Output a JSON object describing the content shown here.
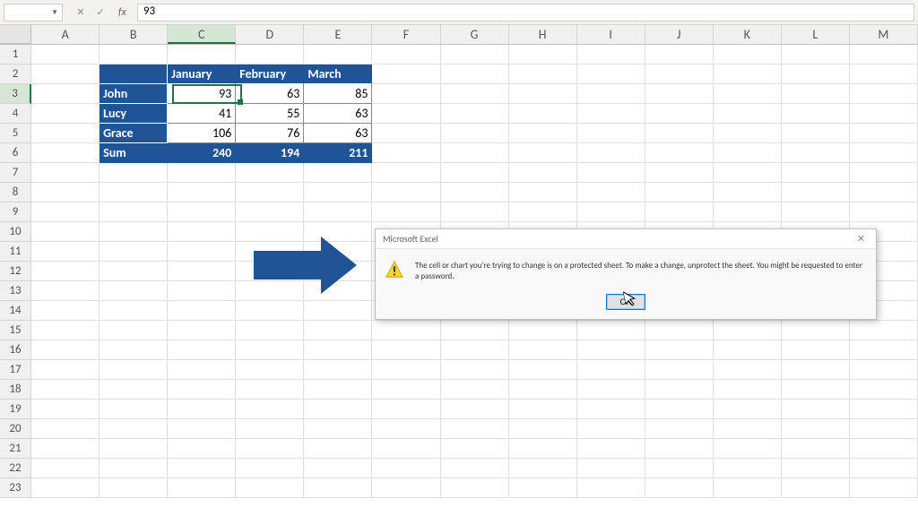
{
  "formula_bar": {
    "name_box": "",
    "value": "93",
    "cancel_icon": "✕",
    "enter_icon": "✓",
    "fx_label": "fx"
  },
  "columns": [
    "A",
    "B",
    "C",
    "D",
    "E",
    "F",
    "G",
    "H",
    "I",
    "J",
    "K",
    "L",
    "M"
  ],
  "rows": [
    1,
    2,
    3,
    4,
    5,
    6,
    7,
    8,
    9,
    10,
    11,
    12,
    13,
    14,
    15,
    16,
    17,
    18,
    19,
    20,
    21,
    22,
    23
  ],
  "selected": {
    "col": "C",
    "row": 3
  },
  "table": {
    "corner": "",
    "headers": [
      "January",
      "February",
      "March"
    ],
    "row_labels": [
      "John",
      "Lucy",
      "Grace",
      "Sum"
    ],
    "data": [
      [
        93,
        63,
        85
      ],
      [
        41,
        55,
        63
      ],
      [
        106,
        76,
        63
      ]
    ],
    "sums": [
      240,
      194,
      211
    ]
  },
  "dialog": {
    "title": "Microsoft Excel",
    "message": "The cell or chart you're trying to change is on a protected sheet. To make a change, unprotect the sheet. You might be requested to enter a password.",
    "ok_label": "OK",
    "close_icon": "✕"
  },
  "chart_data": {
    "type": "table",
    "title": "",
    "columns": [
      "",
      "January",
      "February",
      "March"
    ],
    "rows": [
      [
        "John",
        93,
        63,
        85
      ],
      [
        "Lucy",
        41,
        55,
        63
      ],
      [
        "Grace",
        106,
        76,
        63
      ],
      [
        "Sum",
        240,
        194,
        211
      ]
    ]
  }
}
